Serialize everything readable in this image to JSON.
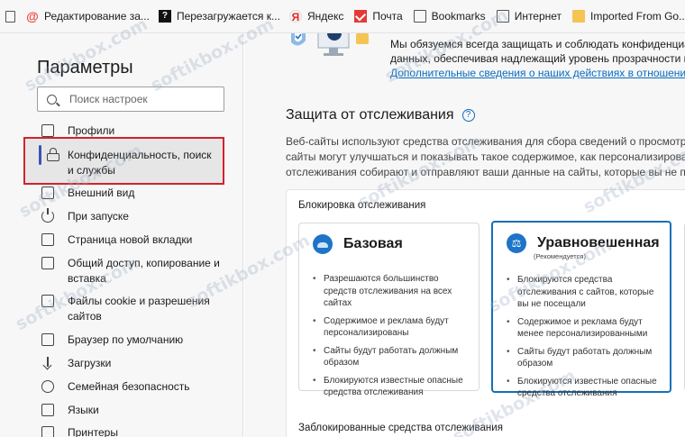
{
  "bookmarks": [
    {
      "icon": "page-icon",
      "label": ""
    },
    {
      "icon": "at-icon",
      "label": "Редактирование за..."
    },
    {
      "icon": "question-icon",
      "label": "Перезагружается к..."
    },
    {
      "icon": "yandex-icon",
      "label": "Яндекс"
    },
    {
      "icon": "mail-icon",
      "label": "Почта"
    },
    {
      "icon": "page-icon",
      "label": "Bookmarks"
    },
    {
      "icon": "page-icon",
      "label": "Интернет"
    },
    {
      "icon": "folder-icon",
      "label": "Imported From Go..."
    }
  ],
  "sidebar": {
    "title": "Параметры",
    "search_placeholder": "Поиск настроек",
    "items": [
      {
        "label": "Профили",
        "icon": "profile-icon"
      },
      {
        "label": "Конфиденциальность, поиск и службы",
        "icon": "lock-icon",
        "active": true
      },
      {
        "label": "Внешний вид",
        "icon": "appearance-icon"
      },
      {
        "label": "При запуске",
        "icon": "power-icon"
      },
      {
        "label": "Страница новой вкладки",
        "icon": "new-tab-icon"
      },
      {
        "label": "Общий доступ, копирование и вставка",
        "icon": "share-icon"
      },
      {
        "label": "Файлы cookie и разрешения сайтов",
        "icon": "cookie-icon"
      },
      {
        "label": "Браузер по умолчанию",
        "icon": "browser-icon"
      },
      {
        "label": "Загрузки",
        "icon": "download-icon"
      },
      {
        "label": "Семейная безопасность",
        "icon": "family-icon"
      },
      {
        "label": "Языки",
        "icon": "language-icon"
      },
      {
        "label": "Принтеры",
        "icon": "printer-icon"
      }
    ]
  },
  "main": {
    "hero_line1": "Мы обязуемся всегда защищать и соблюдать конфиденциальн",
    "hero_line2": "данных, обеспечивая надлежащий уровень прозрачности и ко",
    "hero_link": "Дополнительные сведения о наших действиях в отношении кон",
    "section_title": "Защита от отслеживания",
    "section_desc": [
      "Веб-сайты используют средства отслеживания для сбора сведений о просмотре стр",
      "сайты могут улучшаться и показывать такое содержимое, как персонализированна",
      "отслеживания собирают и отправляют ваши данные на сайты, которые вы не посещ"
    ],
    "card_title": "Блокировка отслеживания",
    "options": [
      {
        "name": "Базовая",
        "recommended": "",
        "bullets": [
          "Разрешаются большинство средств отслеживания на всех сайтах",
          "Содержимое и реклама будут персонализированы",
          "Сайты будут работать должным образом",
          "Блокируются известные опасные средства отслеживания"
        ]
      },
      {
        "name": "Уравновешенная",
        "recommended": "(Рекомендуется)",
        "bullets": [
          "Блокируются средства отслеживания с сайтов, которые вы не посещали",
          "Содержимое и реклама будут менее персонализированными",
          "Сайты будут работать должным образом",
          "Блокируются известные опасные средства отслеживания"
        ]
      }
    ],
    "blocked_title": "Заблокированные средства отслеживания"
  },
  "watermark": "softikbox.com",
  "colors": {
    "accent": "#1470b8",
    "link": "#0a6cbf",
    "highlight": "#d0242c"
  }
}
